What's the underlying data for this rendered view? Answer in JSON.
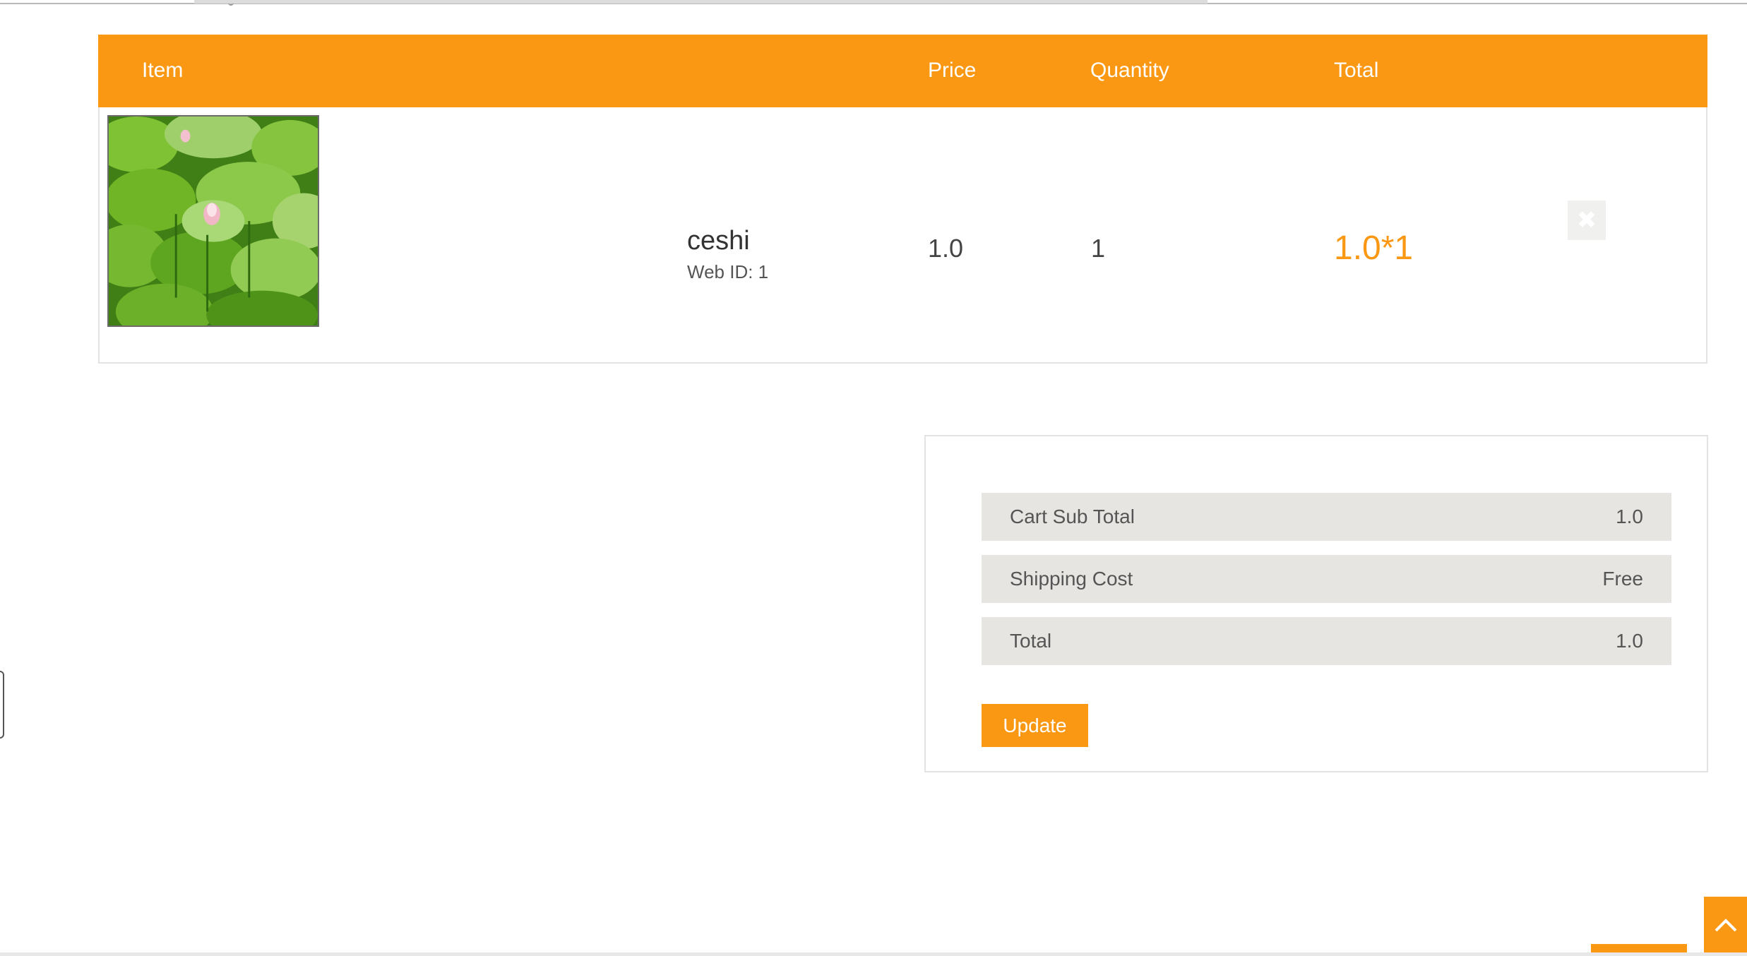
{
  "cart": {
    "headers": {
      "item": "Item",
      "price": "Price",
      "quantity": "Quantity",
      "total": "Total"
    },
    "items": [
      {
        "name": "ceshi",
        "web_id": "Web ID: 1",
        "price": "1.0",
        "quantity": "1",
        "total": "1.0*1",
        "image_icon": "lotus-pond-image",
        "remove_icon": "close-icon"
      }
    ]
  },
  "summary": {
    "rows": [
      {
        "label": "Cart Sub Total",
        "value": "1.0"
      },
      {
        "label": "Shipping Cost",
        "value": "Free"
      },
      {
        "label": "Total",
        "value": "1.0"
      }
    ],
    "update_label": "Update"
  },
  "scroll_top_icon": "chevron-up-icon",
  "colors": {
    "accent": "#fb9813",
    "row_bg": "#e6e5e1",
    "border": "#e3e3e3"
  }
}
